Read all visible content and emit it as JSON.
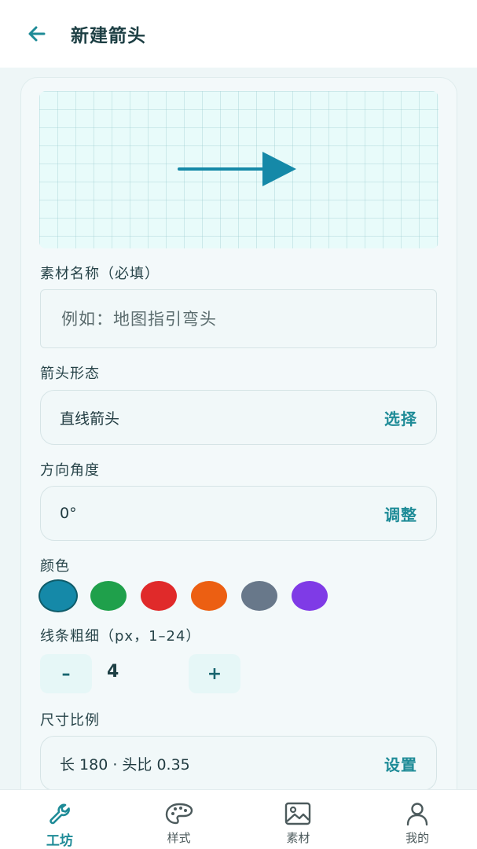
{
  "header": {
    "title": "新建箭头"
  },
  "form": {
    "name_label": "素材名称（必填）",
    "name_placeholder": "例如：地图指引弯头",
    "shape_label": "箭头形态",
    "shape_value": "直线箭头",
    "shape_action": "选择",
    "angle_label": "方向角度",
    "angle_value": "0°",
    "angle_action": "调整",
    "color_label": "颜色",
    "colors": [
      "#1589a8",
      "#1fa04b",
      "#e02a2a",
      "#ec5f12",
      "#68788a",
      "#7f3be6"
    ],
    "selected_color": "#1589a8",
    "stroke_label": "线条粗细（px，1–24）",
    "stroke_minus": "–",
    "stroke_value": "4",
    "stroke_plus": "+",
    "size_label": "尺寸比例",
    "size_value": "长 180 · 头比 0.35",
    "size_action": "设置"
  },
  "preview": {
    "arrow_color": "#1589a8",
    "stroke_px": 4,
    "length": 180,
    "head_ratio": 0.35,
    "angle_deg": 0
  },
  "nav": {
    "items": [
      {
        "label": "工坊",
        "icon": "wrench-icon",
        "active": true
      },
      {
        "label": "样式",
        "icon": "palette-icon",
        "active": false
      },
      {
        "label": "素材",
        "icon": "image-icon",
        "active": false
      },
      {
        "label": "我的",
        "icon": "user-icon",
        "active": false
      }
    ]
  }
}
